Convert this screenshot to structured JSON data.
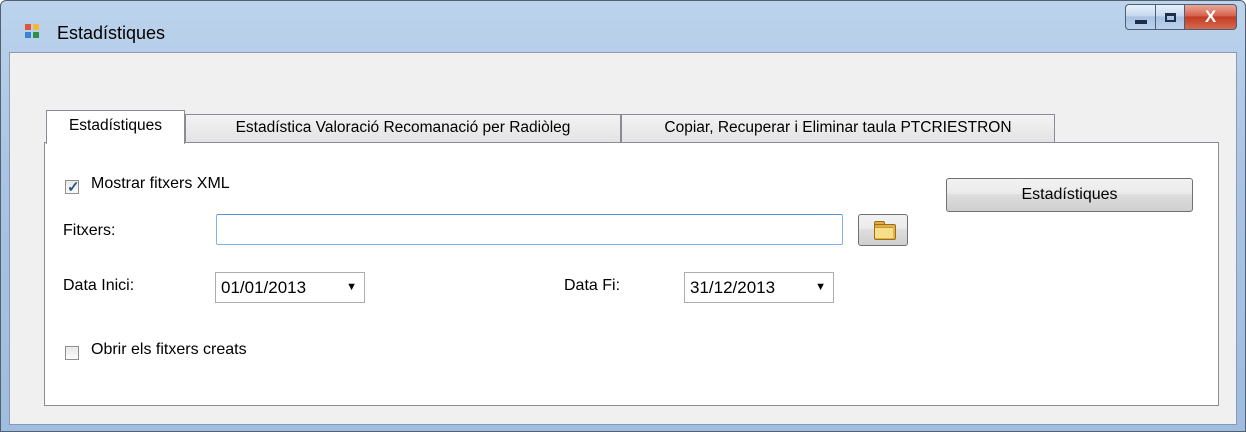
{
  "window": {
    "title": "Estadístiques",
    "controls": {
      "minimize": "minimize-icon",
      "maximize": "maximize-icon",
      "close": "X"
    }
  },
  "tabs": [
    {
      "label": "Estadístiques",
      "active": true
    },
    {
      "label": "Estadística Valoració Recomanació per Radiòleg",
      "active": false
    },
    {
      "label": "Copiar, Recuperar i Eliminar taula PTCRIESTRON",
      "active": false
    }
  ],
  "form": {
    "show_xml": {
      "label": "Mostrar fitxers XML",
      "checked": true
    },
    "files_label": "Fitxers:",
    "files_value": "",
    "browse_icon": "folder-icon",
    "start_date": {
      "label": "Data Inici:",
      "value": "01/01/2013"
    },
    "end_date": {
      "label": "Data Fi:",
      "value": "31/12/2013"
    },
    "open_files": {
      "label": "Obrir els fitxers creats",
      "checked": false
    },
    "stats_button": "Estadístiques"
  },
  "colors": {
    "title_bar": "#a9c4e4",
    "close_button": "#c23c23",
    "client_bg": "#f0f0f0",
    "input_border_focus": "#7eb4ea"
  }
}
